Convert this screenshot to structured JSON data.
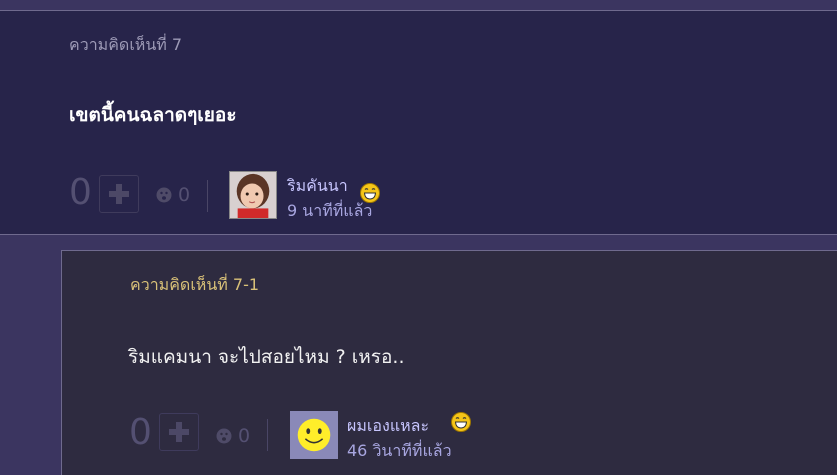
{
  "comments": [
    {
      "number_label": "ความคิดเห็นที่ 7",
      "text": "เขตนี้คนฉลาดๆเยอะ",
      "vote_count": "0",
      "emotion_count": "0",
      "user_name": "ริมคันนา",
      "time_ago": "9 นาทีที่แล้ว",
      "mood_icon": "laughing-face-icon",
      "avatar": "girl-photo-avatar"
    },
    {
      "number_label": "ความคิดเห็นที่ 7-1",
      "text": "ริมแคมนา จะไปสอยไหม ?   เหรอ..",
      "vote_count": "0",
      "emotion_count": "0",
      "user_name": "ผมเองแหละ",
      "time_ago": "46 วินาทีที่แล้ว",
      "mood_icon": "laughing-face-icon",
      "avatar": "smiley-avatar"
    }
  ],
  "colors": {
    "page_background": "#3b3560",
    "comment_background": "#27244a",
    "reply_background": "#2e2b40",
    "reply_number_color": "#d9c178",
    "user_name_color": "#c8c6ff"
  }
}
